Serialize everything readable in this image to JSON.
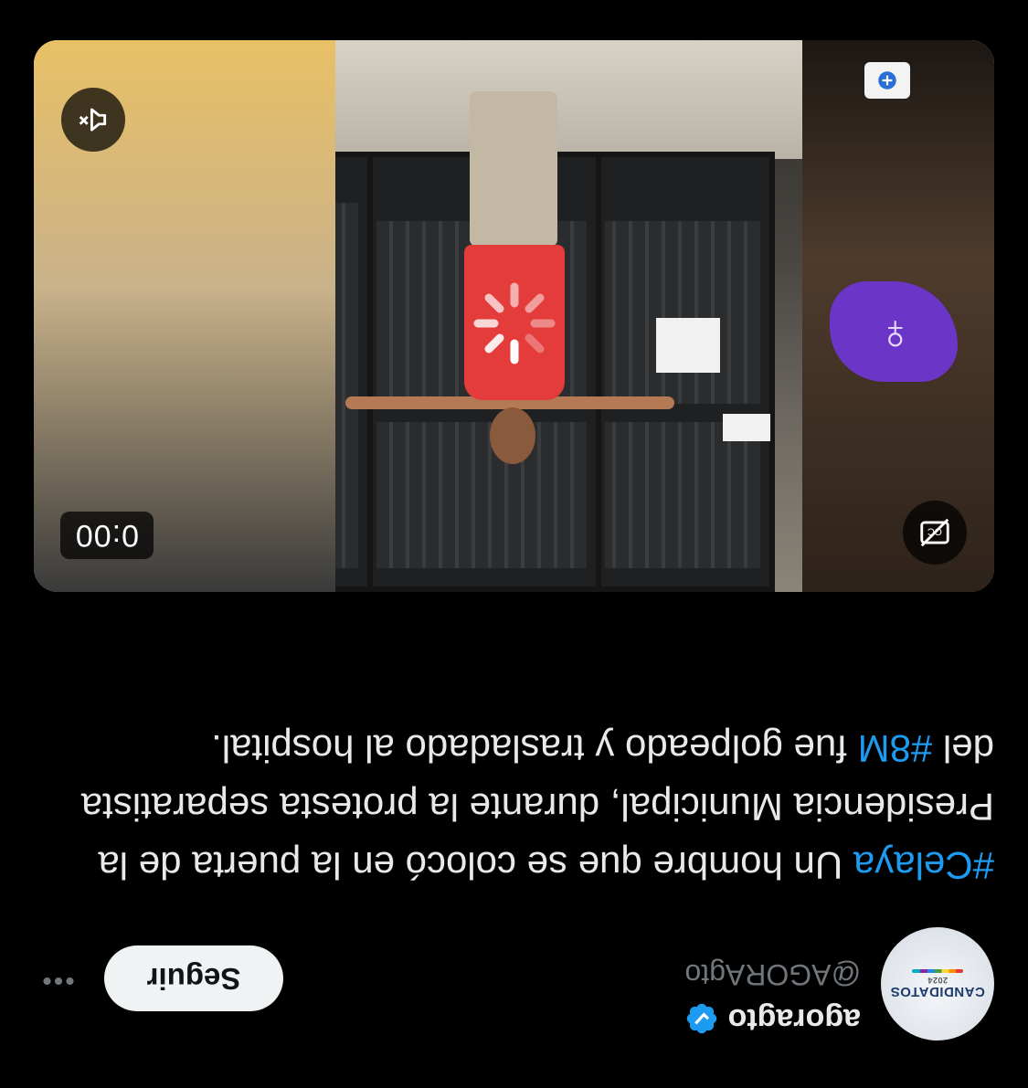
{
  "author": {
    "display_name": "agoragto",
    "handle": "@AGORAgto",
    "avatar_text": "CANDIDATOS",
    "avatar_year": "2024",
    "verified": true
  },
  "actions": {
    "follow_label": "Seguir",
    "more_label": "•••"
  },
  "tweet": {
    "hashtag_1": "#Celaya",
    "text_part_1": " Un hombre que se colocó en la puerta de la Presidencia Municipal, durante la protesta separatista del ",
    "hashtag_2": "#8M",
    "text_part_2": " fue golpeado y trasladado al hospital."
  },
  "media": {
    "type": "video",
    "timestamp": "0:00",
    "loading": true,
    "captions_icon": "captions-off-icon",
    "mute_icon": "muted-speaker-icon",
    "colors": {
      "shirt": "#e43b3b",
      "scarf": "#6b35c8"
    }
  },
  "colors": {
    "background": "#000000",
    "link": "#1d9bf0",
    "verified": "#1d9bf0",
    "text": "#e7e9ea",
    "secondary": "#71767b"
  }
}
